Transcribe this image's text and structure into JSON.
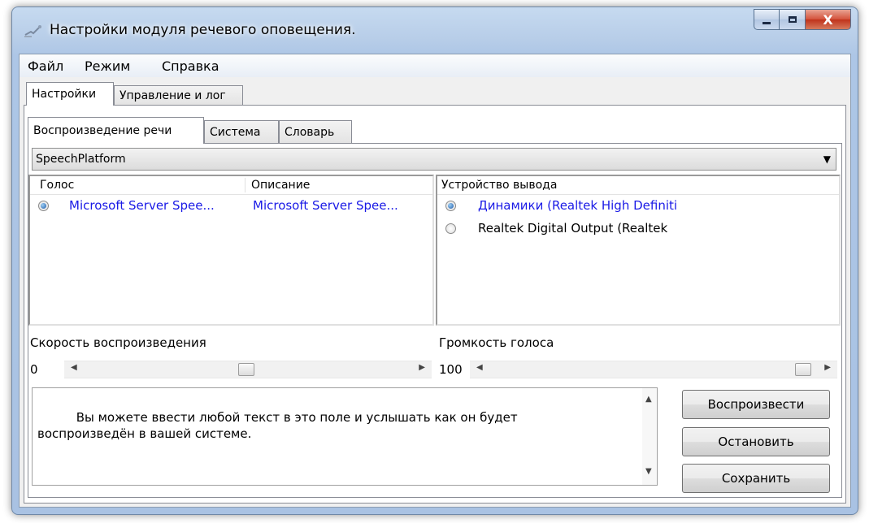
{
  "window": {
    "title": "Настройки модуля речевого оповещения.",
    "close_glyph": "X"
  },
  "menu": [
    "Файл",
    "Режим",
    "Справка"
  ],
  "outer_tabs": [
    "Настройки",
    "Управление и лог"
  ],
  "inner_tabs": [
    "Воспроизведение речи",
    "Система",
    "Словарь"
  ],
  "engine": {
    "selected": "SpeechPlatform"
  },
  "voices": {
    "headers": [
      "Голос",
      "Описание"
    ],
    "rows": [
      {
        "selected": true,
        "name": "Microsoft Server Spee...",
        "description": "Microsoft Server Spee..."
      }
    ]
  },
  "devices": {
    "header": "Устройство вывода",
    "rows": [
      {
        "selected": true,
        "name": "Динамики (Realtek High Definiti"
      },
      {
        "selected": false,
        "name": "Realtek Digital Output (Realtek"
      }
    ]
  },
  "speed": {
    "label": "Скорость воспроизведения",
    "value": "0",
    "position": 0.5
  },
  "volume": {
    "label": "Громкость голоса",
    "value": "100",
    "position": 1.0
  },
  "text_input": "Вы можете ввести любой текст в это поле и услышать как он будет\nвоспроизведён в вашей системе.",
  "buttons": {
    "play": "Воспроизвести",
    "stop": "Остановить",
    "save": "Сохранить"
  },
  "colors": {
    "link_text": "#1a1ae6",
    "title_bar": "#b7cde8"
  }
}
